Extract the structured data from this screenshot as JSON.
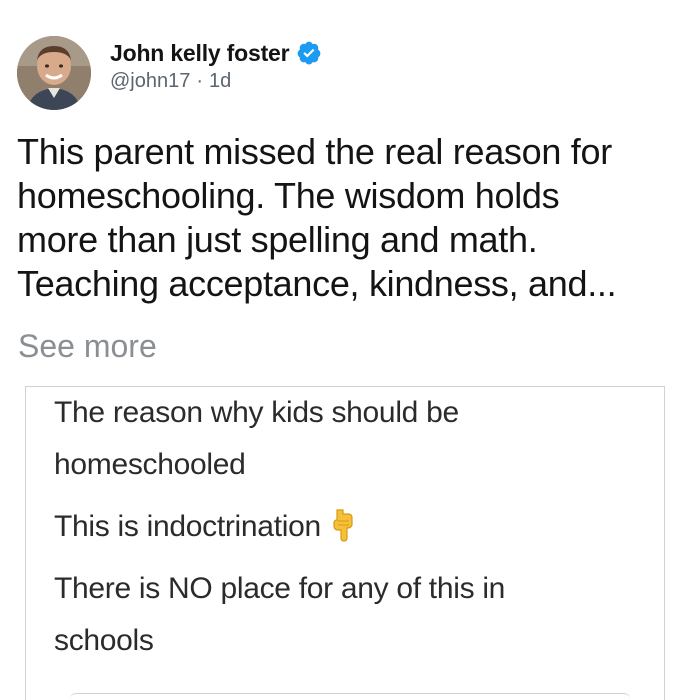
{
  "post": {
    "author": {
      "display_name": "John kelly foster",
      "verified": true,
      "verified_icon": "verified-badge-icon",
      "handle": "@john17",
      "separator": "·",
      "time_ago": "1d"
    },
    "body_lines": [
      "This parent missed the real reason for",
      "homeschooling. The wisdom holds",
      "more than just spelling and math.",
      "Teaching acceptance, kindness, and..."
    ],
    "see_more": "See more"
  },
  "embedded_image": {
    "lines": [
      "The reason why kids should be",
      "homeschooled",
      "This is indoctrination",
      "There is NO place for any of this in",
      "schools"
    ],
    "emoji": "point-down-icon"
  },
  "colors": {
    "verified_blue": "#1d9bf0",
    "secondary_text": "#5b6670",
    "see_more": "#8a8f94",
    "border": "#cfd3d6"
  }
}
